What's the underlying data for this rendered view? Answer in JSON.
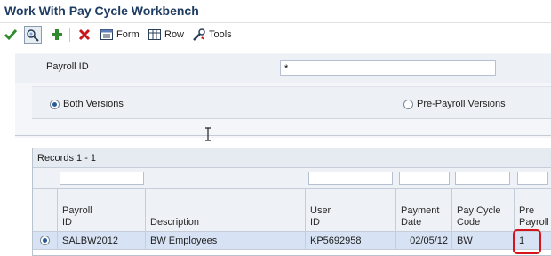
{
  "window": {
    "title": "Work With Pay Cycle Workbench"
  },
  "toolbar": {
    "select_icon": "checkmark-icon",
    "find_icon": "find-binoculars-icon",
    "add_icon": "plus-icon",
    "delete_icon": "x-icon",
    "form_label": "Form",
    "row_label": "Row",
    "tools_label": "Tools"
  },
  "form": {
    "payroll_id_label": "Payroll ID",
    "payroll_id_value": "*",
    "radios": [
      {
        "label": "Both Versions",
        "checked": true
      },
      {
        "label": "Pre-Payroll Versions",
        "checked": false
      }
    ]
  },
  "grid": {
    "records_label": "Records 1 - 1",
    "columns": [
      {
        "label": "Payroll\nID"
      },
      {
        "label": "Description"
      },
      {
        "label": "User\nID"
      },
      {
        "label": "Payment\nDate"
      },
      {
        "label": "Pay Cycle\nCode"
      },
      {
        "label": "Pre\nPayroll"
      }
    ],
    "rows": [
      {
        "payroll_id": "SALBW2012",
        "description": "BW Employees",
        "user_id": "KP5692958",
        "payment_date": "02/05/12",
        "pay_cycle_code": "BW",
        "pre_payroll": "1",
        "selected": true
      }
    ]
  },
  "colors": {
    "title": "#1f3c62",
    "accent_highlight": "#d4151b",
    "selected_row": "#d7e3f4"
  }
}
